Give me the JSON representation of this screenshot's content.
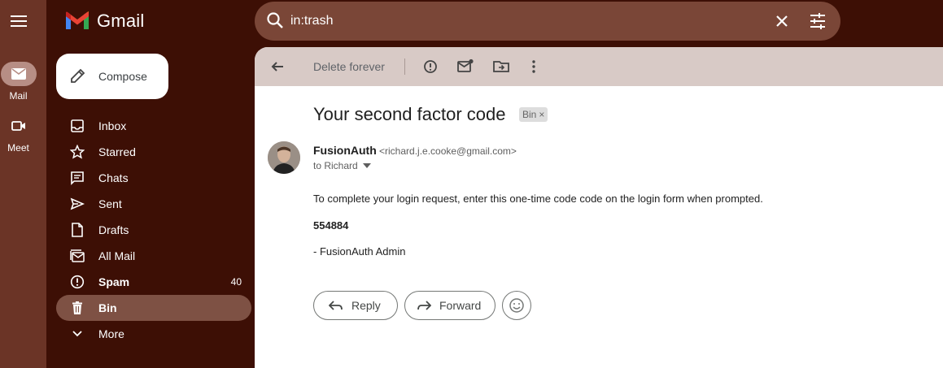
{
  "app": {
    "name": "Gmail"
  },
  "rail": {
    "apps": [
      {
        "label": "Mail",
        "icon": "mail-icon",
        "active": true
      },
      {
        "label": "Meet",
        "icon": "video-camera-icon",
        "active": false
      }
    ]
  },
  "search": {
    "query": "in:trash"
  },
  "compose": {
    "label": "Compose"
  },
  "nav": {
    "items": [
      {
        "label": "Inbox",
        "icon": "inbox-icon",
        "count": ""
      },
      {
        "label": "Starred",
        "icon": "star-icon",
        "count": ""
      },
      {
        "label": "Chats",
        "icon": "chat-icon",
        "count": ""
      },
      {
        "label": "Sent",
        "icon": "send-icon",
        "count": ""
      },
      {
        "label": "Drafts",
        "icon": "draft-icon",
        "count": ""
      },
      {
        "label": "All Mail",
        "icon": "all-mail-icon",
        "count": ""
      },
      {
        "label": "Spam",
        "icon": "spam-icon",
        "count": "40"
      },
      {
        "label": "Bin",
        "icon": "trash-icon",
        "count": ""
      },
      {
        "label": "More",
        "icon": "chevron-down-icon",
        "count": ""
      }
    ]
  },
  "toolbar": {
    "delete_forever_label": "Delete forever"
  },
  "email": {
    "subject": "Your second factor code",
    "label": "Bin",
    "sender_name": "FusionAuth",
    "sender_email": "<richard.j.e.cooke@gmail.com>",
    "recipient": "to Richard",
    "body_intro": "To complete your login request, enter this one-time code code on the login form when prompted.",
    "code": "554884",
    "signature": "- FusionAuth Admin"
  },
  "actions": {
    "reply_label": "Reply",
    "forward_label": "Forward"
  },
  "colors": {
    "background": "#3d0f05",
    "rail": "#6b3426",
    "search": "#7a4637",
    "toolbar": "#d8cac6",
    "active_nav": "#7e5144"
  }
}
